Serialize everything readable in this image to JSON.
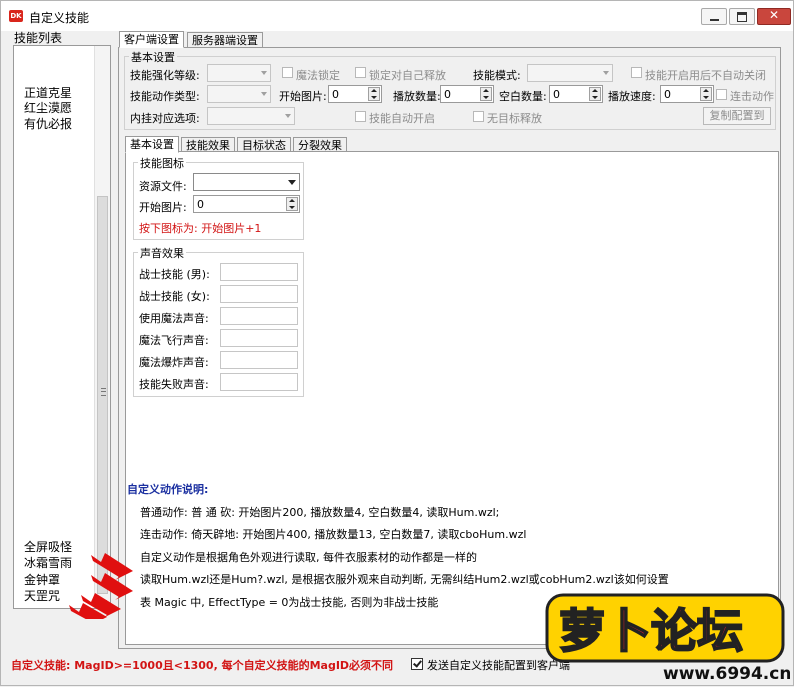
{
  "window": {
    "title": "自定义技能",
    "icon_text": "DK"
  },
  "left": {
    "label": "技能列表",
    "items_top": [
      "正道克星",
      "红尘漠愿",
      "有仇必报"
    ],
    "items_bottom": [
      "全屏吸怪",
      "冰霜雪雨",
      "金钟罩",
      "天罡咒"
    ]
  },
  "tabs_top": [
    "客户端设置",
    "服务器端设置"
  ],
  "basic": {
    "title": "基本设置",
    "row1": {
      "level_label": "技能强化等级:",
      "magic_lock": "魔法锁定",
      "lock_self": "锁定对自己释放",
      "mode_label": "技能模式:",
      "auto_close": "技能开启用后不自动关闭"
    },
    "row2": {
      "action_label": "技能动作类型:",
      "start_img_label": "开始图片:",
      "start_img": "0",
      "play_count_label": "播放数量:",
      "play_count": "0",
      "blank_count_label": "空白数量:",
      "blank_count": "0",
      "play_speed_label": "播放速度:",
      "play_speed": "0",
      "combo": "连击动作"
    },
    "row3": {
      "hook_label": "内挂对应选项:",
      "auto_on": "技能自动开启",
      "no_target": "无目标释放",
      "copy_btn": "复制配置到"
    }
  },
  "tabs_inner": [
    "基本设置",
    "技能效果",
    "目标状态",
    "分裂效果"
  ],
  "icon_group": {
    "title": "技能图标",
    "resource_label": "资源文件:",
    "start_label": "开始图片:",
    "start_value": "0",
    "hint": "按下图标为: 开始图片+1"
  },
  "sound_group": {
    "title": "声音效果",
    "fields": [
      "战士技能 (男):",
      "战士技能 (女):",
      "使用魔法声音:",
      "魔法飞行声音:",
      "魔法爆炸声音:",
      "技能失败声音:"
    ]
  },
  "desc": {
    "title": "自定义动作说明:",
    "lines": [
      "普通动作: 普 通 砍: 开始图片200, 播放数量4, 空白数量4, 读取Hum.wzl;",
      "连击动作: 倚天辟地: 开始图片400, 播放数量13, 空白数量7, 读取cboHum.wzl",
      "自定义动作是根据角色外观进行读取, 每件衣服素材的动作都是一样的",
      "读取Hum.wzl还是Hum?.wzl, 是根据衣服外观来自动判断, 无需纠结Hum2.wzl或cobHum2.wzl该如何设置",
      "表 Magic 中, EffectType = 0为战士技能, 否则为非战士技能"
    ]
  },
  "footer": {
    "warning": "自定义技能: MagID>=1000且<1300, 每个自定义技能的MagID必须不同",
    "send_label": "发送自定义技能配置到客户端",
    "send_checked": true
  },
  "watermark": {
    "text": "萝卜论坛",
    "url": "www.6994.cn"
  },
  "colors": {
    "warning": "#d21414",
    "desc_title": "#1a2fa0",
    "hint": "#d21414",
    "arrow": "#e01010",
    "close": "#c9463d"
  }
}
